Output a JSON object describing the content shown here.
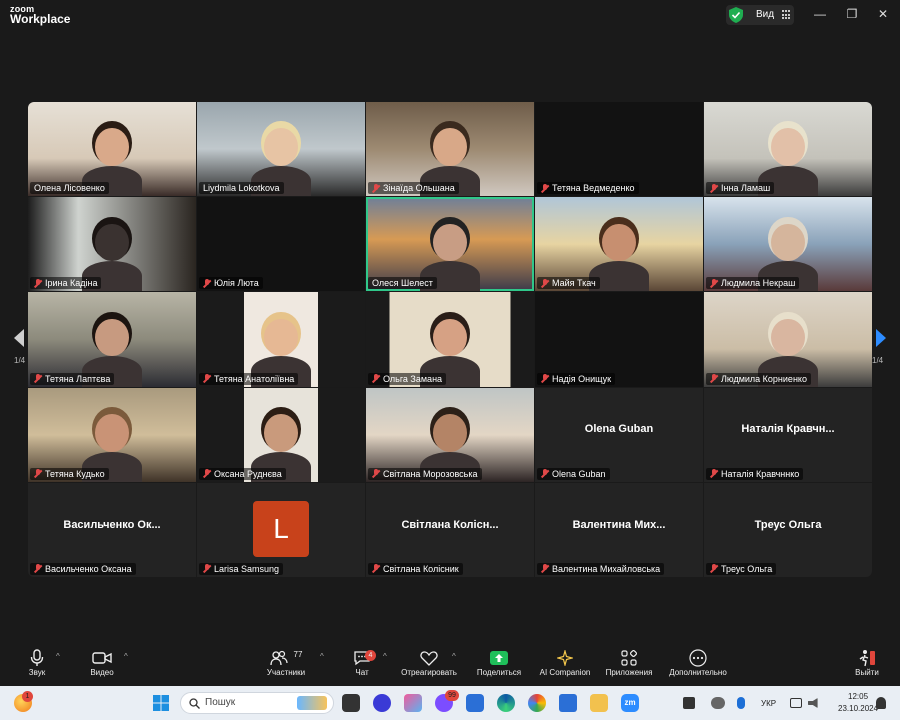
{
  "app": {
    "logo_top": "zoom",
    "logo_bottom": "Workplace"
  },
  "titlebar": {
    "view_label": "Вид",
    "minimize": "—",
    "maximize": "❐",
    "close": "✕",
    "shield_color": "#1fae51"
  },
  "pager": {
    "left_label": "1/4",
    "right_label": "1/4"
  },
  "tiles": [
    {
      "name": "Олена Лісовенко",
      "muted": false,
      "video": true
    },
    {
      "name": "Liydmila Lokotkova",
      "muted": false,
      "video": true
    },
    {
      "name": "Зінаїда Ольшана",
      "muted": true,
      "video": true
    },
    {
      "name": "Тетяна Ведмеденко",
      "muted": true,
      "video": true
    },
    {
      "name": "Інна Ламаш",
      "muted": true,
      "video": true
    },
    {
      "name": "Ірина Кадіна",
      "muted": true,
      "video": true
    },
    {
      "name": "Юлія Люта",
      "muted": true,
      "video": true
    },
    {
      "name": "Олеся Шелест",
      "muted": false,
      "video": true,
      "active": true
    },
    {
      "name": "Майя Ткач",
      "muted": true,
      "video": true
    },
    {
      "name": "Людмила Некраш",
      "muted": true,
      "video": true
    },
    {
      "name": "Тетяна Лаптєва",
      "muted": true,
      "video": true
    },
    {
      "name": "Тетяна Анатоліївна",
      "muted": true,
      "video": true
    },
    {
      "name": "Ольга Замана",
      "muted": true,
      "video": true
    },
    {
      "name": "Надія Онищук",
      "muted": true,
      "video": true
    },
    {
      "name": "Людмила Корниенко",
      "muted": true,
      "video": true
    },
    {
      "name": "Тетяна Кудько",
      "muted": true,
      "video": true
    },
    {
      "name": "Оксана Руднєва",
      "muted": true,
      "video": true
    },
    {
      "name": "Світлана Морозовська",
      "muted": true,
      "video": true
    },
    {
      "name": "Olena Guban",
      "muted": true,
      "video": false,
      "big_name": "Olena Guban"
    },
    {
      "name": "Наталія Кравчннко",
      "muted": true,
      "video": false,
      "big_name": "Наталія Кравчн..."
    },
    {
      "name": "Васильченко Оксана",
      "muted": true,
      "video": false,
      "big_name": "Васильченко Ок..."
    },
    {
      "name": "Larisa Samsung",
      "muted": true,
      "video": false,
      "avatar_letter": "L",
      "avatar_color": "#c8421b"
    },
    {
      "name": "Світлана Колісник",
      "muted": true,
      "video": false,
      "big_name": "Світлана Колісн..."
    },
    {
      "name": "Валентина Михайловська",
      "muted": true,
      "video": false,
      "big_name": "Валентина Мих..."
    },
    {
      "name": "Треус Ольга",
      "muted": true,
      "video": false,
      "big_name": "Треус Ольга"
    }
  ],
  "toolbar": {
    "audio": "Звук",
    "video": "Видео",
    "participants": "Участники",
    "participants_count": "77",
    "chat": "Чат",
    "chat_badge": "4",
    "react": "Отреагировать",
    "share": "Поделиться",
    "ai": "AI Companion",
    "apps": "Приложения",
    "more": "Дополнительно",
    "leave": "Выйти",
    "share_color": "#1fbf5a",
    "leave_color": "#e0463c"
  },
  "taskbar": {
    "search_placeholder": "Пошук",
    "notif_badge": "1",
    "teams_badge": "99",
    "lang": "УКР",
    "time": "12:05",
    "date": "23.10.2024"
  }
}
